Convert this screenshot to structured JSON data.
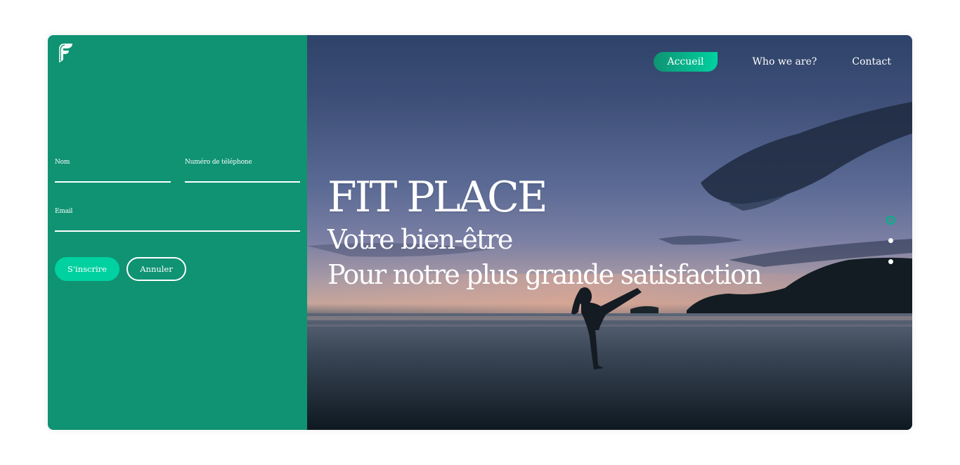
{
  "brand": {
    "logo_icon": "fit-place-leaf-f-logo",
    "primary_color": "#0f9373",
    "accent_color": "#00d1a0"
  },
  "form": {
    "name_label": "Nom",
    "name_value": "",
    "phone_label": "Numéro de téléphone",
    "phone_value": "",
    "email_label": "Email",
    "email_value": "",
    "submit_label": "S'inscrire",
    "cancel_label": "Annuler"
  },
  "nav": {
    "items": [
      {
        "label": "Accueil",
        "active": true
      },
      {
        "label": "Who we are?",
        "active": false
      },
      {
        "label": "Contact",
        "active": false
      }
    ]
  },
  "hero": {
    "title": "FIT PLACE",
    "subtitle_line1": "Votre bien-être",
    "subtitle_line2": "Pour notre plus grande satisfaction"
  },
  "slider": {
    "total": 3,
    "active_index": 0
  }
}
